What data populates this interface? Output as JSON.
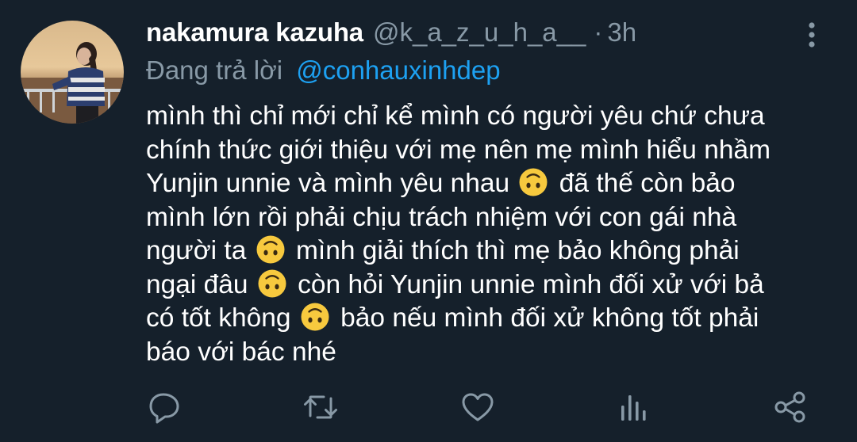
{
  "tweet": {
    "display_name": "nakamura kazuha",
    "handle": "@k_a_z_u_h_a__",
    "separator": "·",
    "time": "3h",
    "reply_prefix": "Đang trả lời",
    "reply_to": "@conhauxinhdep",
    "body_lines": [
      [
        "mình thì chỉ mới chỉ kể mình có người yêu chứ chưa"
      ],
      [
        "chính thức giới thiệu với mẹ nên mẹ mình hiểu nhầm"
      ],
      [
        "Yunjin unnie và mình yêu nhau",
        "đã thế còn bảo"
      ],
      [
        "mình lớn rồi phải chịu trách nhiệm với con gái nhà"
      ],
      [
        "người ta",
        "mình giải thích thì mẹ bảo không phải"
      ],
      [
        "ngại đâu",
        "còn hỏi Yunjin unnie mình đối xử với bả"
      ],
      [
        "có tốt không",
        "bảo nếu mình đối xử không tốt phải"
      ],
      [
        "báo với bác nhé"
      ]
    ]
  },
  "icons": {
    "avatar": "profile-photo",
    "more": "more-vertical-icon",
    "emoji": "upside-down-face-emoji",
    "actions": [
      "reply-icon",
      "retweet-icon",
      "like-icon",
      "analytics-icon",
      "share-icon"
    ]
  },
  "colors": {
    "background": "#15202b",
    "text": "#ffffff",
    "secondary": "#8899a6",
    "link": "#1da1f2",
    "emoji": "#f7c93e"
  }
}
